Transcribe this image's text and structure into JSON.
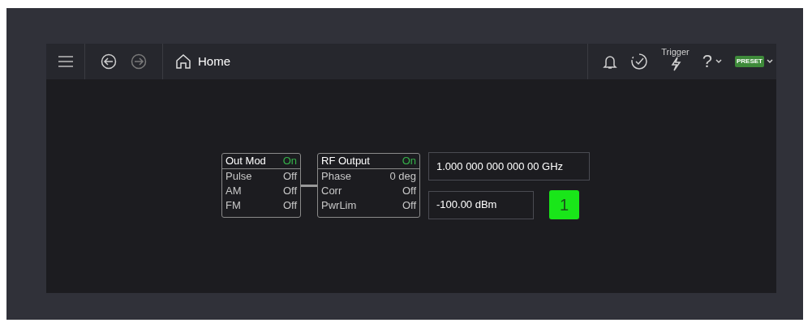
{
  "toolbar": {
    "nav": [
      {
        "kind": "back",
        "disabled": false
      },
      {
        "kind": "forward",
        "disabled": true
      }
    ],
    "home": {
      "label": "Home"
    },
    "trigger": {
      "label": "Trigger"
    },
    "help": {
      "label": "?"
    },
    "preset": {
      "label": "PRESET"
    }
  },
  "blocks": [
    {
      "title": "Out Mod",
      "status": "On",
      "on": true,
      "rows": [
        {
          "label": "Pulse",
          "value": "Off",
          "on": false
        },
        {
          "label": "AM",
          "value": "Off",
          "on": false
        },
        {
          "label": "FM",
          "value": "Off",
          "on": false
        }
      ]
    },
    {
      "title": "RF Output",
      "status": "On",
      "on": true,
      "rows": [
        {
          "label": "Phase",
          "value": "0 deg",
          "on": false
        },
        {
          "label": "Corr",
          "value": "Off",
          "on": false
        },
        {
          "label": "PwrLim",
          "value": "Off",
          "on": false
        }
      ]
    }
  ],
  "frequency": "1.000 000 000 000 00 GHz",
  "power": "-100.00 dBm",
  "channel": {
    "label": "1",
    "on": true
  }
}
